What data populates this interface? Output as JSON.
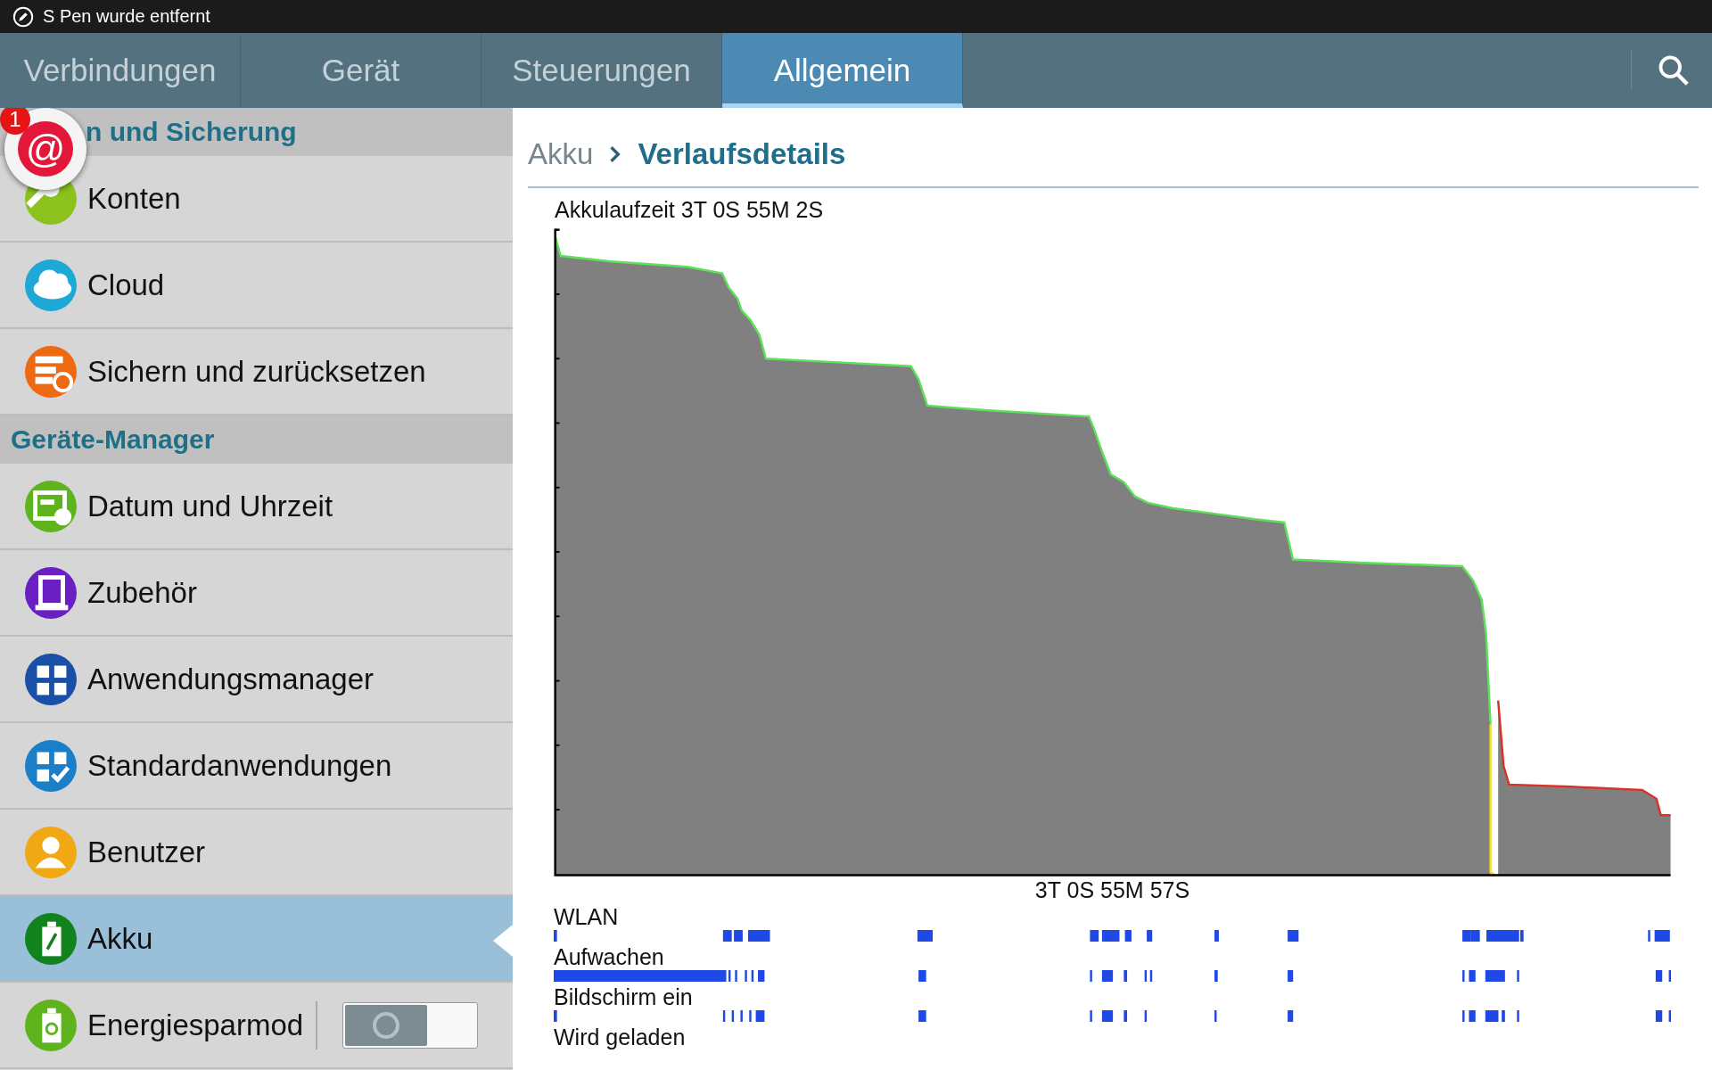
{
  "status_bar": {
    "notification": "S Pen wurde entfernt"
  },
  "tabs": [
    {
      "label": "Verbindungen",
      "selected": false
    },
    {
      "label": "Gerät",
      "selected": false
    },
    {
      "label": "Steuerungen",
      "selected": false
    },
    {
      "label": "Allgemein",
      "selected": true
    }
  ],
  "floating_bubble": {
    "symbol": "@",
    "count": "1"
  },
  "sidebar": [
    {
      "kind": "header",
      "label": "n und Sicherung"
    },
    {
      "kind": "item",
      "label": "Konten",
      "color": "#8cc21e",
      "selected": false
    },
    {
      "kind": "item",
      "label": "Cloud",
      "color": "#1ea8d6",
      "selected": false
    },
    {
      "kind": "item",
      "label": "Sichern und zurücksetzen",
      "color": "#ee6a12",
      "selected": false
    },
    {
      "kind": "header",
      "label": "Geräte-Manager"
    },
    {
      "kind": "item",
      "label": "Datum und Uhrzeit",
      "color": "#5fb41e",
      "selected": false
    },
    {
      "kind": "item",
      "label": "Zubehör",
      "color": "#6a1fc2",
      "selected": false
    },
    {
      "kind": "item",
      "label": "Anwendungsmanager",
      "color": "#1a4fa8",
      "selected": false
    },
    {
      "kind": "item",
      "label": "Standardanwendungen",
      "color": "#1a7fc8",
      "selected": false
    },
    {
      "kind": "item",
      "label": "Benutzer",
      "color": "#f0a814",
      "selected": false
    },
    {
      "kind": "item",
      "label": "Akku",
      "color": "#12821e",
      "selected": true
    },
    {
      "kind": "toggle",
      "label": "Energiesparmod",
      "color": "#5fb41e",
      "selected": false,
      "on": false
    }
  ],
  "breadcrumb": {
    "parent": "Akku",
    "current": "Verlaufsdetails"
  },
  "battery": {
    "runtime": "Akkulaufzeit 3T 0S 55M 2S",
    "axis_label": "3T 0S 55M 57S",
    "events": [
      {
        "label": "WLAN"
      },
      {
        "label": "Aufwachen"
      },
      {
        "label": "Bildschirm ein"
      },
      {
        "label": "Wird geladen"
      }
    ]
  }
}
